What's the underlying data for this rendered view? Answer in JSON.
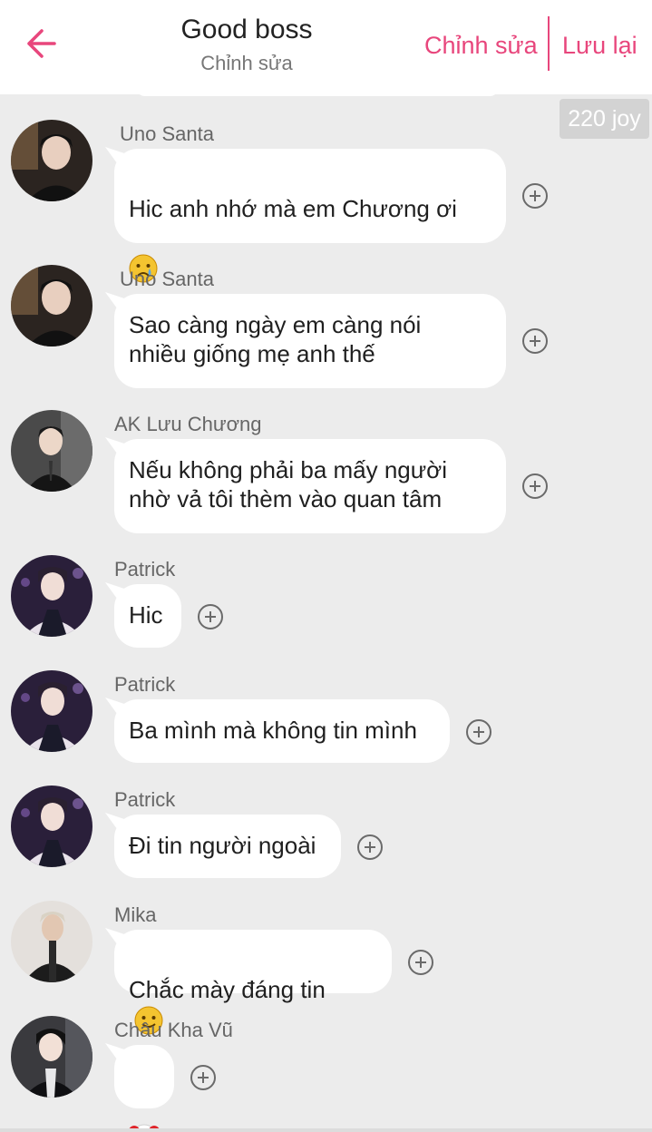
{
  "header": {
    "title": "Good boss",
    "subtitle": "Chỉnh sửa",
    "edit_label": "Chỉnh sửa",
    "save_label": "Lưu lại",
    "accent_color": "#e8467c"
  },
  "joy_badge": "220 joy",
  "messages": [
    {
      "sender": "Uno Santa",
      "text": "Hic anh nhớ mà em Chương ơi",
      "emoji": "sad-face-emoji"
    },
    {
      "sender": "Uno Santa",
      "text": "Sao càng ngày em càng nói\nnhiều giống mẹ anh thế"
    },
    {
      "sender": "AK Lưu Chương",
      "text": "Nếu không phải ba mấy người\nnhờ vả tôi thèm vào quan tâm"
    },
    {
      "sender": "Patrick",
      "text": "Hic"
    },
    {
      "sender": "Patrick",
      "text": "Ba mình mà không tin mình"
    },
    {
      "sender": "Patrick",
      "text": "Đi tin người ngoài"
    },
    {
      "sender": "Mika",
      "text": "Chắc mày đáng tin",
      "emoji": "slight-smile-emoji"
    },
    {
      "sender": "Châu Kha Vũ",
      "text": "",
      "emoji": "clown-emoji"
    }
  ]
}
